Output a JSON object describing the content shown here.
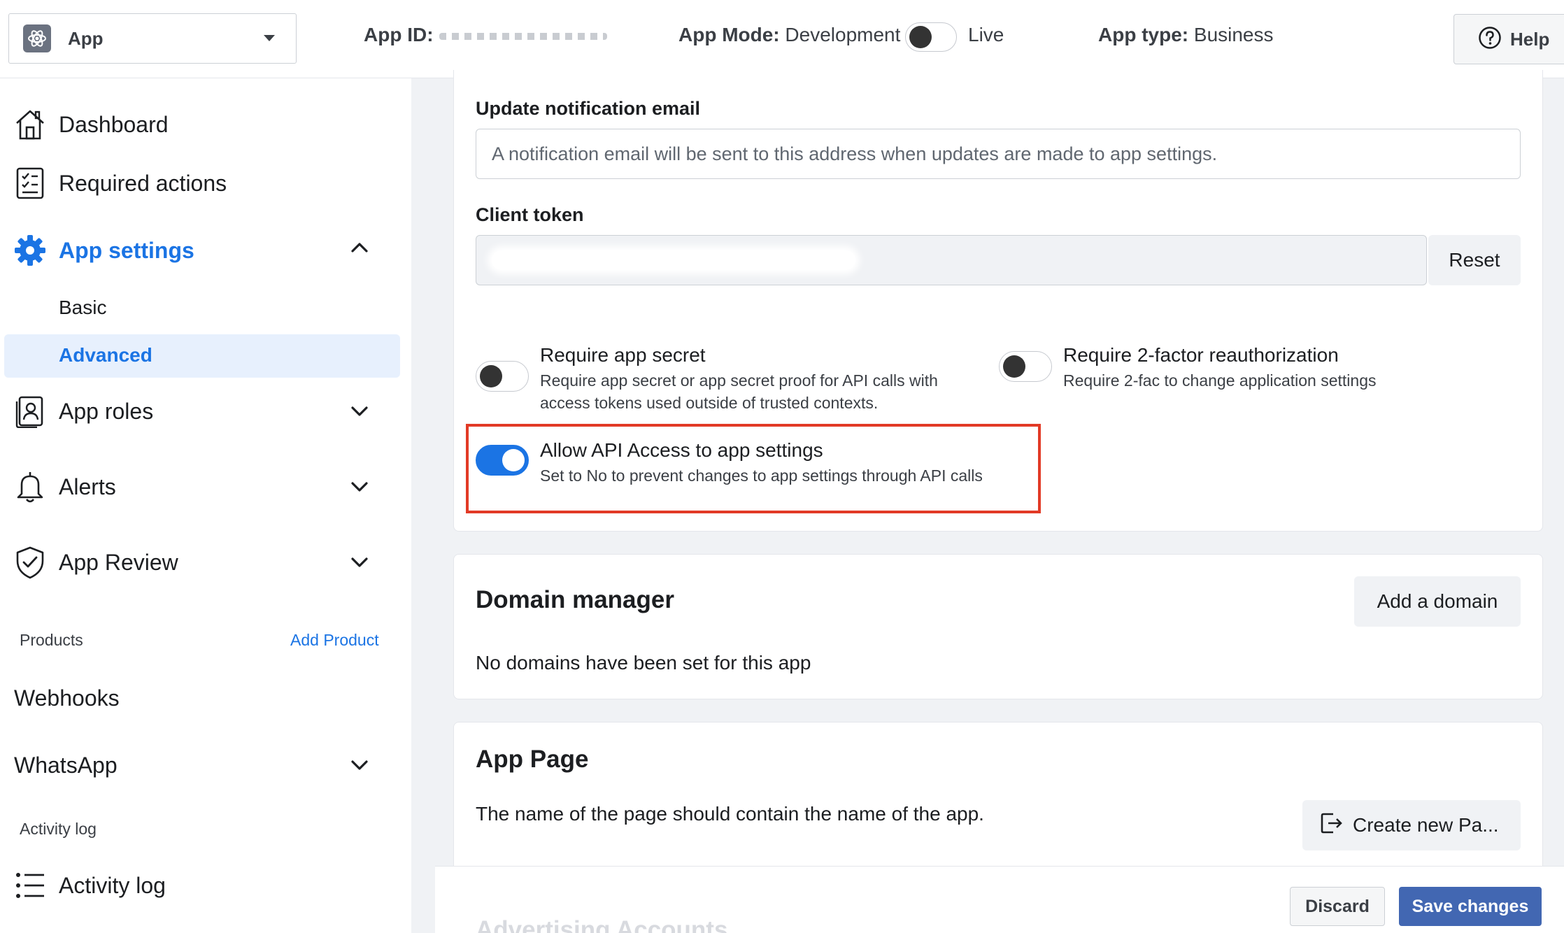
{
  "topbar": {
    "app_name": "App",
    "app_id_label": "App ID:",
    "app_mode_label": "App Mode:",
    "app_mode_value": "Development",
    "live_label": "Live",
    "app_type_label": "App type:",
    "app_type_value": "Business",
    "help_label": "Help"
  },
  "sidebar": {
    "dashboard": "Dashboard",
    "required_actions": "Required actions",
    "app_settings": "App settings",
    "basic": "Basic",
    "advanced": "Advanced",
    "app_roles": "App roles",
    "alerts": "Alerts",
    "app_review": "App Review",
    "products_label": "Products",
    "add_product": "Add Product",
    "webhooks": "Webhooks",
    "whatsapp": "WhatsApp",
    "activity_log_section": "Activity log",
    "activity_log": "Activity log"
  },
  "security": {
    "update_email_label": "Update notification email",
    "update_email_placeholder": "A notification email will be sent to this address when updates are made to app settings.",
    "client_token_label": "Client token",
    "reset_label": "Reset",
    "require_secret_title": "Require app secret",
    "require_secret_desc": "Require app secret or app secret proof for API calls with access tokens used outside of trusted contexts.",
    "require_2fa_title": "Require 2-factor reauthorization",
    "require_2fa_desc": "Require 2-fac to change application settings",
    "allow_api_title": "Allow API Access to app settings",
    "allow_api_desc": "Set to No to prevent changes to app settings through API calls"
  },
  "domain_manager": {
    "title": "Domain manager",
    "add_label": "Add a domain",
    "empty_text": "No domains have been set for this app"
  },
  "app_page": {
    "title": "App Page",
    "text": "The name of the page should contain the name of the app.",
    "create_label": "Create new Pa..."
  },
  "footer": {
    "faded_title": "Advertising Accounts",
    "discard_label": "Discard",
    "save_label": "Save changes"
  },
  "colors": {
    "accent": "#1b74e4",
    "highlight": "#e23a26",
    "primary_button": "#4267b2"
  }
}
